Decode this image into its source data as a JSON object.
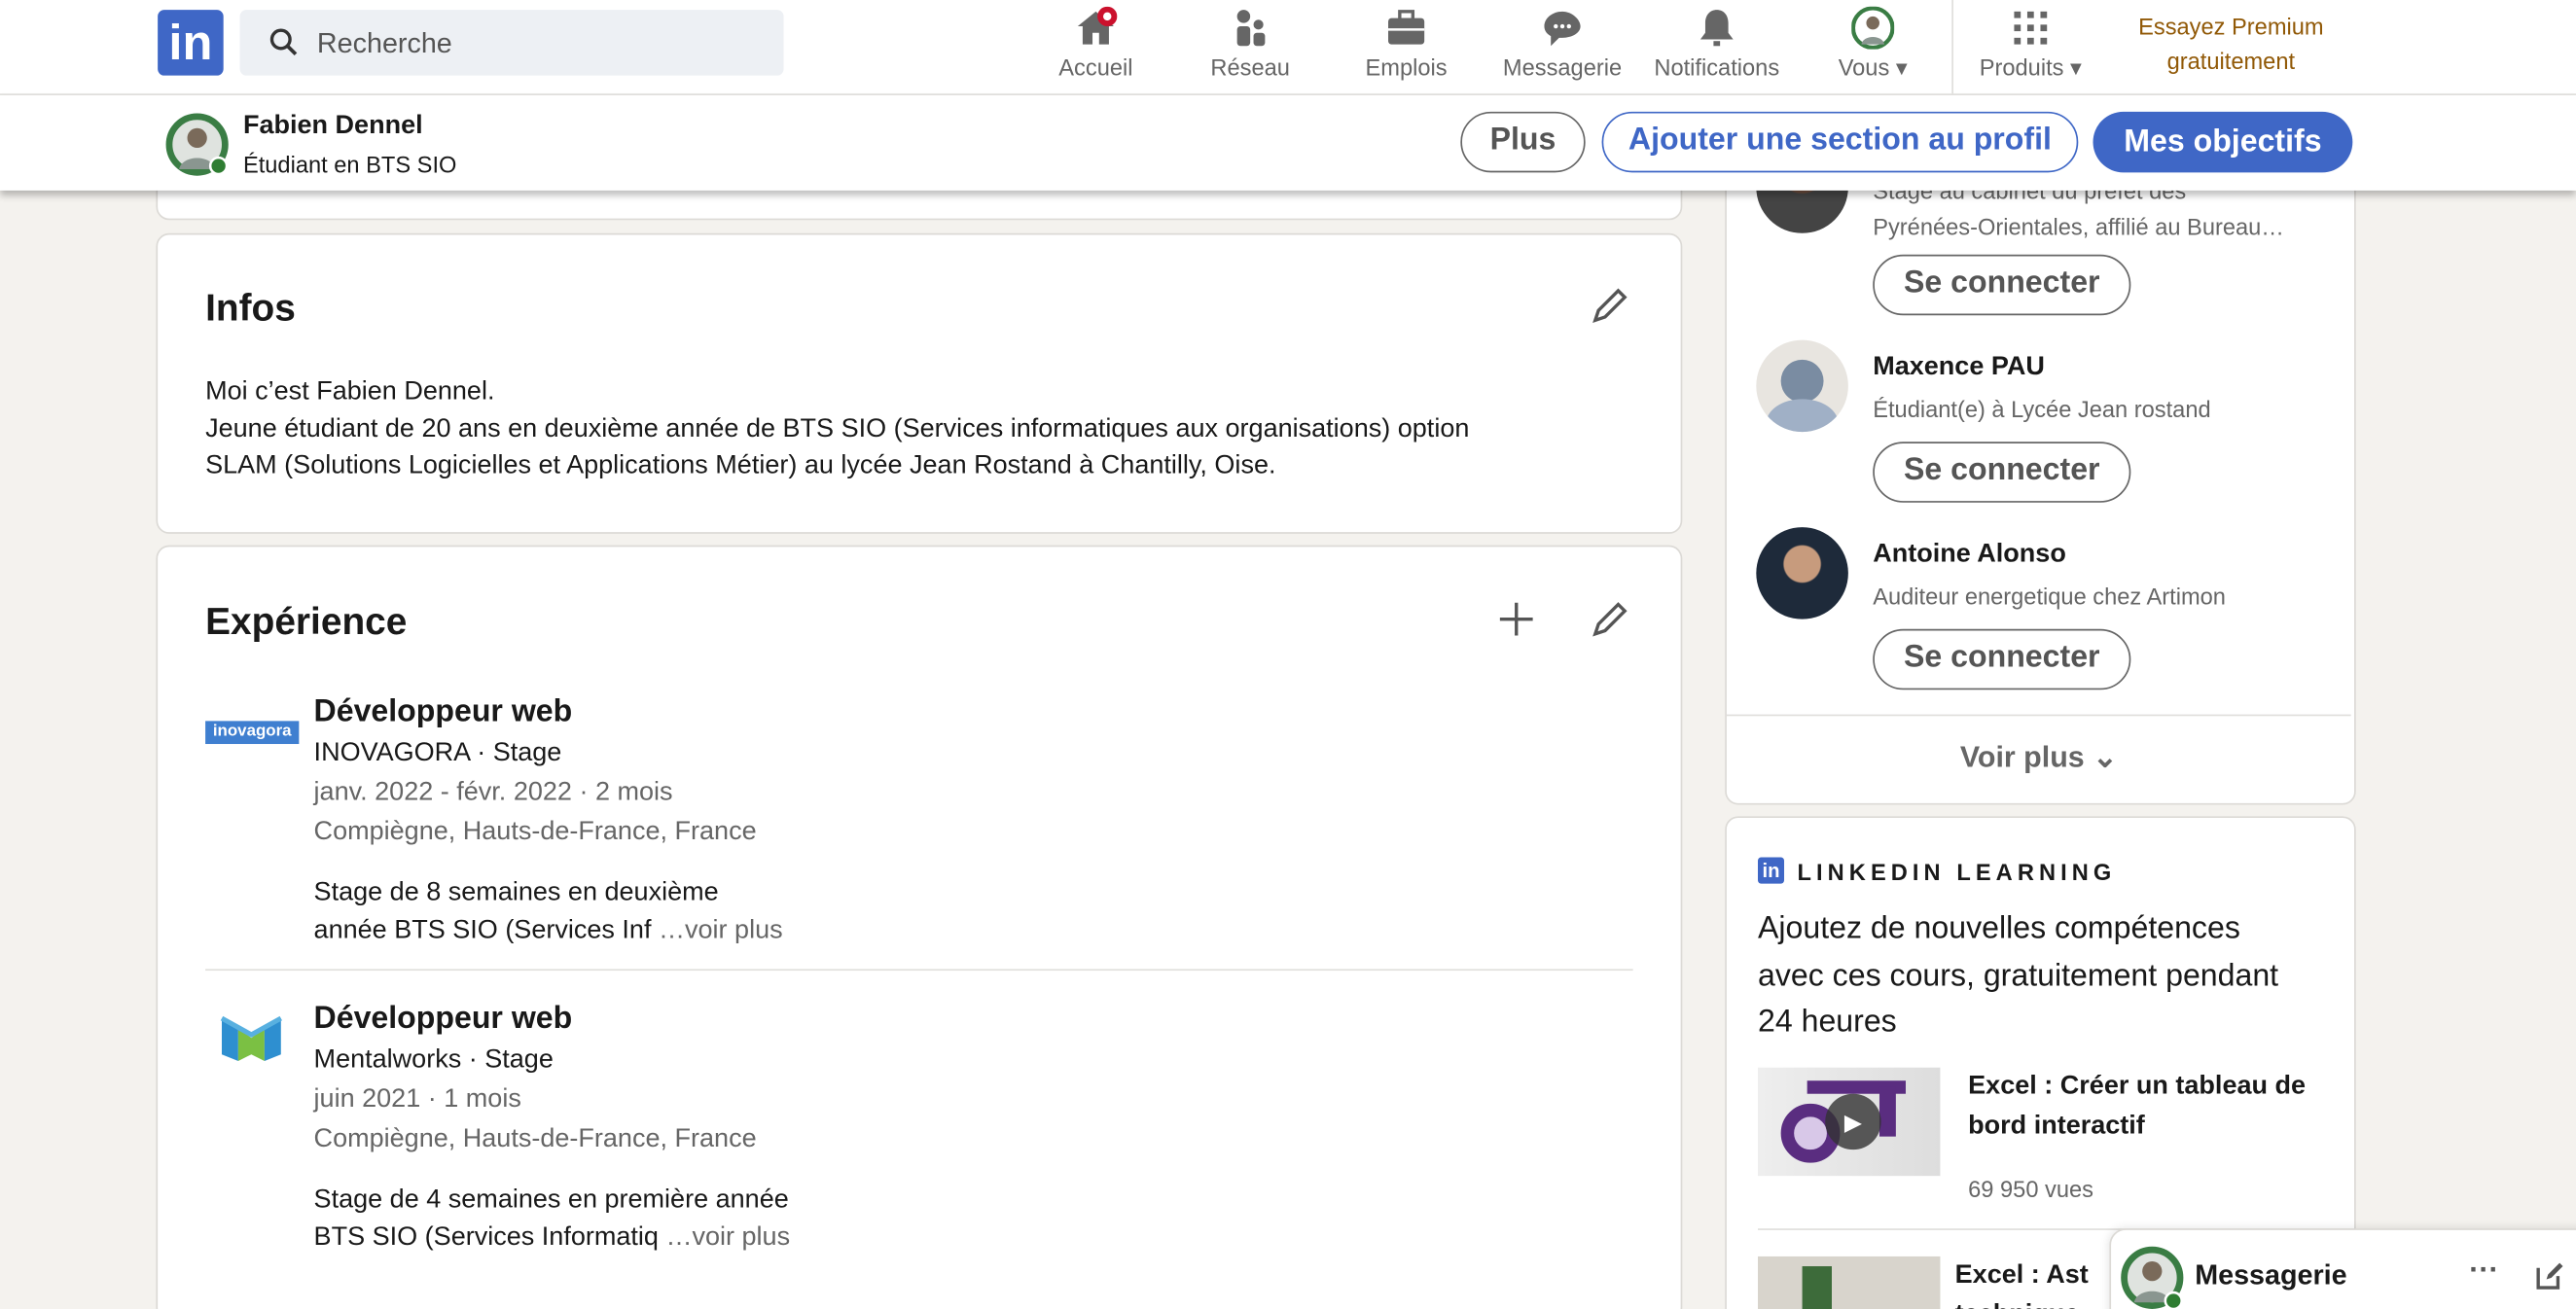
{
  "nav": {
    "logo": "in",
    "search_placeholder": "Recherche",
    "items": [
      {
        "label": "Accueil",
        "icon": "home-icon"
      },
      {
        "label": "Réseau",
        "icon": "network-icon"
      },
      {
        "label": "Emplois",
        "icon": "briefcase-icon"
      },
      {
        "label": "Messagerie",
        "icon": "chat-icon"
      },
      {
        "label": "Notifications",
        "icon": "bell-icon"
      },
      {
        "label": "Vous",
        "icon": "avatar"
      },
      {
        "label": "Produits",
        "icon": "grid-icon"
      }
    ],
    "premium_line1": "Essayez Premium",
    "premium_line2": "gratuitement"
  },
  "profile_bar": {
    "name": "Fabien Dennel",
    "headline": "Étudiant en BTS SIO",
    "more": "Plus",
    "add_section": "Ajouter une section au profil",
    "goals": "Mes objectifs"
  },
  "infos": {
    "title": "Infos",
    "lines": [
      "Moi c’est Fabien Dennel.",
      "Jeune étudiant de 20 ans en deuxième année de BTS SIO (Services informatiques aux organisations) option",
      "SLAM (Solutions Logicielles et Applications Métier) au lycée Jean Rostand à Chantilly, Oise."
    ]
  },
  "experience": {
    "title": "Expérience",
    "items": [
      {
        "logo_text": "inovagora",
        "title": "Développeur web",
        "company": "INOVAGORA · Stage",
        "dates": "janv. 2022 - févr. 2022 · 2 mois",
        "location": "Compiègne, Hauts-de-France, France",
        "desc1": "Stage de 8 semaines en deuxième",
        "desc2": "année BTS SIO (Services Inf",
        "more": "…voir plus"
      },
      {
        "title": "Développeur web",
        "company": "Mentalworks · Stage",
        "dates": "juin 2021 · 1 mois",
        "location": "Compiègne, Hauts-de-France, France",
        "desc1": "Stage de 4 semaines en première année",
        "desc2": "BTS SIO (Services Informatiq",
        "more": "…voir plus"
      }
    ]
  },
  "suggestions": {
    "people": [
      {
        "headline1": "Stage au cabinet du préfet des",
        "headline2": "Pyrénées-Orientales, affilié au Bureau…",
        "button": "Se connecter"
      },
      {
        "name": "Maxence PAU",
        "headline": "Étudiant(e) à Lycée Jean rostand",
        "button": "Se connecter"
      },
      {
        "name": "Antoine Alonso",
        "headline": "Auditeur energetique chez Artimon",
        "button": "Se connecter"
      }
    ],
    "see_more": "Voir plus"
  },
  "learning": {
    "badge": "in",
    "title": "LINKEDIN LEARNING",
    "intro1": "Ajoutez de nouvelles compétences",
    "intro2": "avec ces cours, gratuitement pendant",
    "intro3": "24 heures",
    "courses": [
      {
        "title1": "Excel : Créer un tableau de",
        "title2": "bord interactif",
        "views": "69 950 vues"
      },
      {
        "title1": "Excel : Ast",
        "title2": "technique"
      }
    ]
  },
  "messaging": {
    "label": "Messagerie"
  },
  "colors": {
    "brand": "#0a66c2",
    "accent": "#3f67c6",
    "premium": "#915907",
    "notif": "#cb112d"
  }
}
